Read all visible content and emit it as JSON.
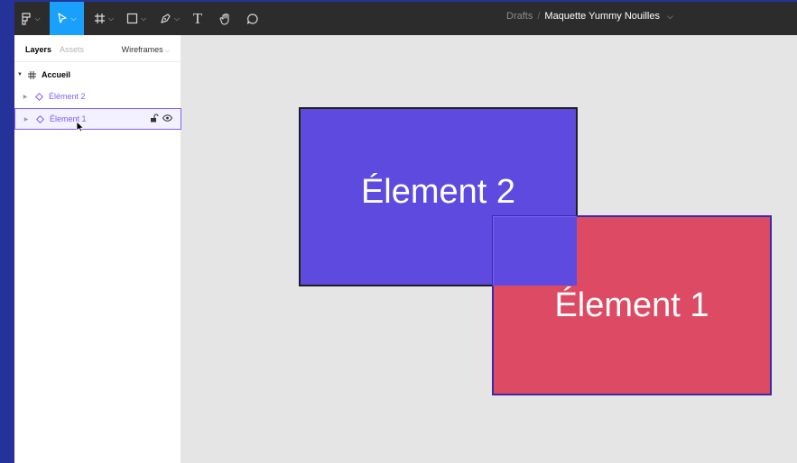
{
  "toolbar": {
    "tools": [
      {
        "name": "main-menu",
        "icon": "figma-menu-icon"
      },
      {
        "name": "move",
        "icon": "cursor-arrow-icon",
        "active": true
      },
      {
        "name": "frame",
        "icon": "frame-hash-icon"
      },
      {
        "name": "shape",
        "icon": "rectangle-icon"
      },
      {
        "name": "pen",
        "icon": "pen-icon"
      },
      {
        "name": "text",
        "icon": "text-icon",
        "label": "T"
      },
      {
        "name": "hand",
        "icon": "hand-icon"
      },
      {
        "name": "comment",
        "icon": "comment-icon"
      }
    ],
    "breadcrumb": {
      "folder": "Drafts",
      "separator": "/",
      "file": "Maquette Yummy Nouilles"
    }
  },
  "left_panel": {
    "tabs": {
      "layers": "Layers",
      "assets": "Assets",
      "page": "Wireframes"
    },
    "layers": [
      {
        "label": "Accueil",
        "type": "frame"
      },
      {
        "label": "Élément 2",
        "type": "component"
      },
      {
        "label": "Élement 1",
        "type": "component",
        "selected": true
      }
    ]
  },
  "canvas": {
    "element_2": {
      "label": "Élement 2"
    },
    "element_1": {
      "label": "Élement 1"
    }
  },
  "colors": {
    "accent": "#18a0fb",
    "element_2_fill": "#5f4ae0",
    "element_1_fill": "#dc4b63",
    "selection": "#7b61ff"
  }
}
